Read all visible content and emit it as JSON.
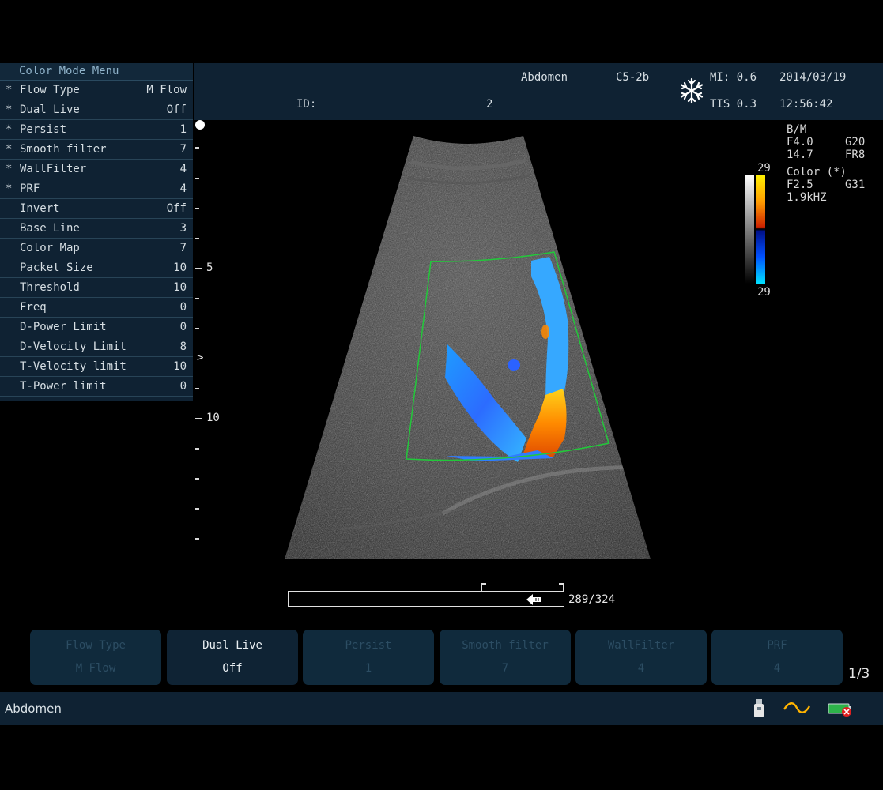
{
  "menu": {
    "title": "Color Mode Menu",
    "items": [
      {
        "star": "*",
        "label": "Flow Type",
        "value": "M Flow"
      },
      {
        "star": "*",
        "label": "Dual Live",
        "value": "Off"
      },
      {
        "star": "*",
        "label": "Persist",
        "value": "1"
      },
      {
        "star": "*",
        "label": "Smooth filter",
        "value": "7"
      },
      {
        "star": "*",
        "label": "WallFilter",
        "value": "4"
      },
      {
        "star": "*",
        "label": "PRF",
        "value": "4"
      },
      {
        "star": "",
        "label": "Invert",
        "value": "Off"
      },
      {
        "star": "",
        "label": "Base Line",
        "value": "3"
      },
      {
        "star": "",
        "label": "Color Map",
        "value": "7"
      },
      {
        "star": "",
        "label": "Packet Size",
        "value": "10"
      },
      {
        "star": "",
        "label": "Threshold",
        "value": "10"
      },
      {
        "star": "",
        "label": "Freq",
        "value": "0"
      },
      {
        "star": "",
        "label": "D-Power Limit",
        "value": "0"
      },
      {
        "star": "",
        "label": "D-Velocity Limit",
        "value": "8"
      },
      {
        "star": "",
        "label": "T-Velocity limit",
        "value": "10"
      },
      {
        "star": "",
        "label": "T-Power limit",
        "value": "0"
      }
    ]
  },
  "header": {
    "exam": "Abdomen",
    "probe": "C5-2b",
    "mi": "MI: 0.6",
    "date": "2014/03/19",
    "id_label": "ID:",
    "id_value": "2",
    "tis": "TIS 0.3",
    "time": "12:56:42",
    "freeze_icon": "snowflake-icon"
  },
  "scale": {
    "label_5": "5",
    "label_10": "10",
    "focus_marker": ">"
  },
  "params": {
    "bm_title": "B/M",
    "bm_freq": "F4.0",
    "bm_gain": "G20",
    "bm_depth": "14.7",
    "bm_fr": "FR8",
    "color_title": "Color (*)",
    "color_freq": "F2.5",
    "color_gain": "G31",
    "color_prf": "1.9kHZ"
  },
  "colorbar": {
    "top": "29",
    "bottom": "29"
  },
  "cine": {
    "frame": "289/324",
    "progress": 0.89
  },
  "softkeys": {
    "page": "1/3",
    "keys": [
      {
        "label": "Flow Type",
        "value": "M Flow",
        "state": "dim"
      },
      {
        "label": "Dual Live",
        "value": "Off",
        "state": "active"
      },
      {
        "label": "Persist",
        "value": "1",
        "state": "dim"
      },
      {
        "label": "Smooth  filter",
        "value": "7",
        "state": "dim"
      },
      {
        "label": "WallFilter",
        "value": "4",
        "state": "dim"
      },
      {
        "label": "PRF",
        "value": "4",
        "state": "dim"
      }
    ]
  },
  "status": {
    "title": "Abdomen",
    "icons": [
      "usb-icon",
      "ecg-wave-icon",
      "battery-icon"
    ]
  },
  "colors": {
    "panel": "#0f2233",
    "roi": "#22c83a",
    "flow_toward": "#ff8a00",
    "flow_away": "#2f8bff"
  }
}
